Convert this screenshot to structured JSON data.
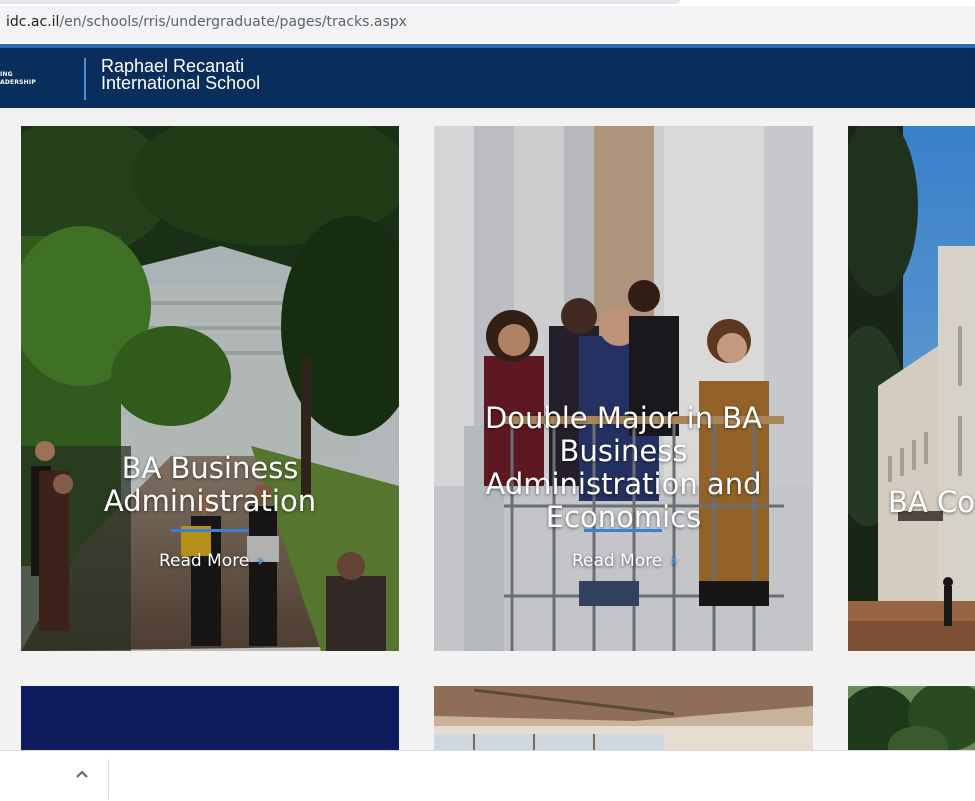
{
  "browser": {
    "url_domain": "idc.ac.il",
    "url_path": "/en/schools/rris/undergraduate/pages/tracks.aspx"
  },
  "header": {
    "logo_line1": "ING",
    "logo_line2": "ADERSHIP",
    "school_line1": "Raphael Recanati",
    "school_line2": "International School"
  },
  "cards": [
    {
      "title_line1": "BA Business",
      "title_line2": "Administration",
      "read_more": "Read More",
      "chevron": "›"
    },
    {
      "title_line1": "Double Major in BA",
      "title_line2": "Business",
      "title_line3": "Administration and",
      "title_line4": "Economics",
      "read_more": "Read More",
      "chevron": "›"
    },
    {
      "title_line1": "BA Co"
    }
  ],
  "download_bar": {
    "caret": "^"
  },
  "colors": {
    "header_bg": "#0a2e5c",
    "accent_blue": "#3b7fd1",
    "page_bg": "#f2f2f2"
  }
}
